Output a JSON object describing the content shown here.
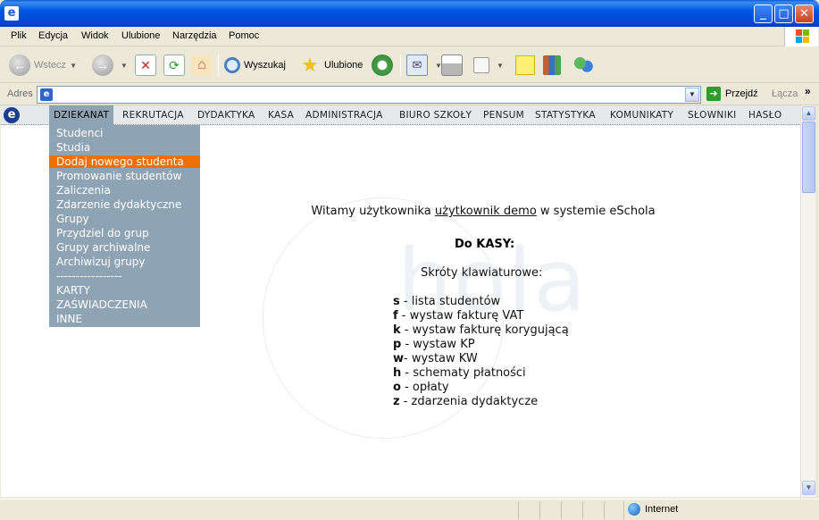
{
  "window": {
    "title": "",
    "app_icon": "e"
  },
  "menu": [
    "Plik",
    "Edycja",
    "Widok",
    "Ulubione",
    "Narzędzia",
    "Pomoc"
  ],
  "toolbar": {
    "back": "Wstecz",
    "search": "Wyszukaj",
    "favorites": "Ulubione"
  },
  "address": {
    "label": "Adres",
    "value": "",
    "go": "Przejdź",
    "links": "Łącza"
  },
  "site_nav": {
    "items": [
      "DZIEKANAT",
      "REKRUTACJA",
      "DYDAKTYKA",
      "KASA",
      "ADMINISTRACJA",
      "BIURO SZKOŁY",
      "PENSUM",
      "STATYSTYKA",
      "KOMUNIKATY",
      "SŁOWNIKI",
      "HASŁO"
    ],
    "active": "DZIEKANAT"
  },
  "dropdown": {
    "items": [
      "Studenci",
      "Studia",
      "Dodaj nowego studenta",
      "Promowanie studentów",
      "Zaliczenia",
      "Zdarzenie dydaktyczne",
      "Grupy",
      "Przydziel do grup",
      "Grupy archiwalne",
      "Archiwizuj grupy",
      "-----------------",
      "KARTY",
      "ZAŚWIADCZENIA",
      "INNE"
    ],
    "highlighted": "Dodaj nowego studenta"
  },
  "main": {
    "welcome_prefix": "Witamy użytkownika",
    "welcome_user": "użytkownik demo",
    "welcome_suffix": "w systemie eSchola",
    "kasa_title": "Do KASY:",
    "shortcuts_title": "Skróty klawiaturowe:",
    "shortcuts": [
      {
        "key": "s",
        "desc": " - lista studentów"
      },
      {
        "key": "f",
        "desc": " - wystaw fakturę VAT"
      },
      {
        "key": "k",
        "desc": " - wystaw fakturę korygującą"
      },
      {
        "key": "p",
        "desc": " - wystaw KP"
      },
      {
        "key": "w",
        "desc": "- wystaw KW"
      },
      {
        "key": "h",
        "desc": " - schematy płatności"
      },
      {
        "key": "o",
        "desc": " - opłaty"
      },
      {
        "key": "z",
        "desc": " - zdarzenia dydaktycze"
      }
    ],
    "watermark": "hola"
  },
  "status": {
    "zone": "Internet"
  },
  "colors": {
    "accent_orange": "#ee7005",
    "menu_bg": "#8ea4b4",
    "xp_blue": "#0055e5"
  }
}
